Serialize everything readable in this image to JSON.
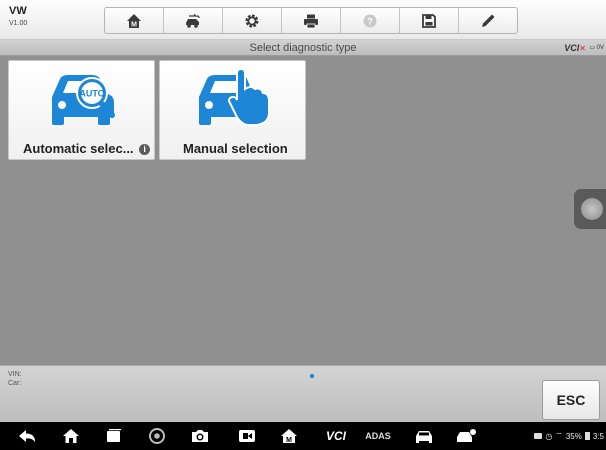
{
  "app": {
    "brand": "VW",
    "version": "V1.00"
  },
  "toolbar": {
    "buttons": [
      {
        "name": "home-button",
        "icon": "home-icon"
      },
      {
        "name": "vehicle-swap-button",
        "icon": "car-swap-icon"
      },
      {
        "name": "settings-button",
        "icon": "gear-icon"
      },
      {
        "name": "print-button",
        "icon": "printer-icon"
      },
      {
        "name": "help-button",
        "icon": "help-icon"
      },
      {
        "name": "save-button",
        "icon": "floppy-icon"
      },
      {
        "name": "annotate-button",
        "icon": "pen-icon"
      }
    ]
  },
  "header": {
    "title": "Select diagnostic type",
    "vci": "VCI",
    "battery_voltage": "0V"
  },
  "tiles": [
    {
      "label": "Automatic selec...",
      "icon": "car-auto-search-icon",
      "info": "i"
    },
    {
      "label": "Manual selection",
      "icon": "car-hand-tap-icon"
    }
  ],
  "info": {
    "vin_label": "VIN:",
    "car_label": "Car:"
  },
  "esc_label": "ESC",
  "nav": {
    "icons": [
      "back-icon",
      "home-icon",
      "recent-apps-icon",
      "chrome-icon",
      "camera-icon",
      "screen-record-icon",
      "maxisys-home-icon",
      "vci-icon",
      "adas-icon",
      "car-icon",
      "car-service-icon"
    ],
    "vci_label": "VCI",
    "adas_label": "ADAS",
    "battery_percent": "35%",
    "clock": "3:5"
  },
  "colors": {
    "accent_blue": "#1e86d7",
    "nav_bg": "#000000",
    "content_bg": "#909090"
  }
}
